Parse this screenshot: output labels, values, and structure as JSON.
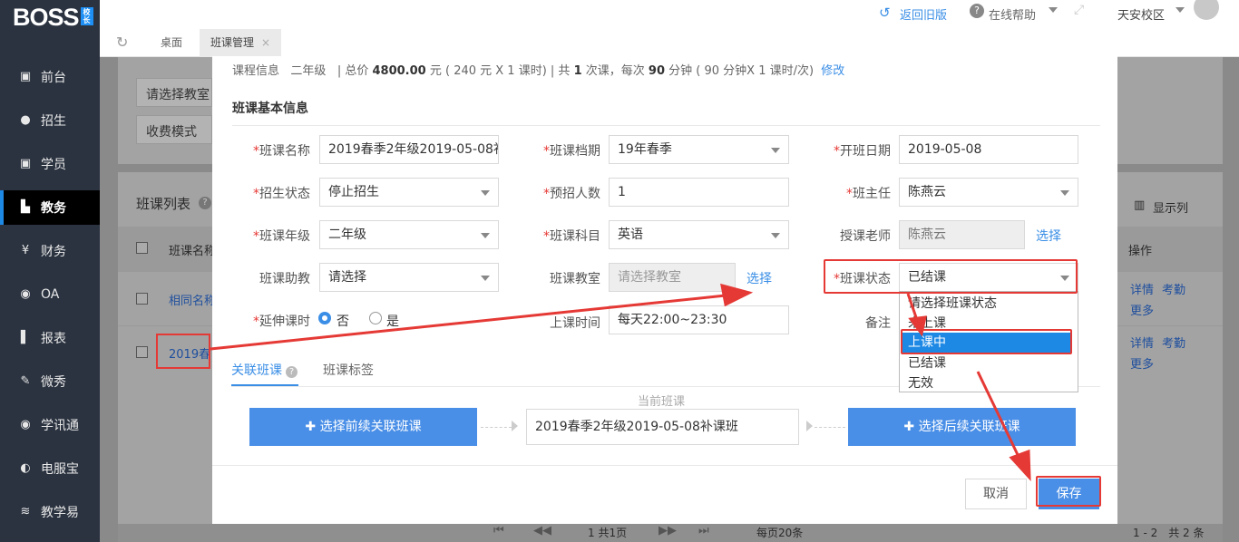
{
  "app": {
    "logo": "BOSS",
    "logo_badge": "校长"
  },
  "topbar": {
    "back_old": "返回旧版",
    "help": "在线帮助",
    "campus": "天安校区"
  },
  "tabs": [
    {
      "label": "桌面"
    },
    {
      "label": "班课管理"
    }
  ],
  "sidebar": {
    "items": [
      {
        "label": "前台",
        "icon": "desk-icon"
      },
      {
        "label": "招生",
        "icon": "person-add-icon"
      },
      {
        "label": "学员",
        "icon": "id-card-icon"
      },
      {
        "label": "教务",
        "icon": "book-icon"
      },
      {
        "label": "财务",
        "icon": "yen-icon"
      },
      {
        "label": "OA",
        "icon": "oa-icon"
      },
      {
        "label": "报表",
        "icon": "chart-icon"
      },
      {
        "label": "微秀",
        "icon": "xiu-icon"
      },
      {
        "label": "学讯通",
        "icon": "location-icon"
      },
      {
        "label": "电服宝",
        "icon": "phone-icon"
      },
      {
        "label": "教学易",
        "icon": "teach-icon"
      }
    ]
  },
  "background": {
    "filter_classroom": "请选择教室",
    "filter_fee": "收费模式",
    "list_title": "班课列表",
    "display_columns": "显示列",
    "col_name": "班课名称",
    "col_action": "操作",
    "row1_name": "相同名称",
    "row2_name": "2019春",
    "action_detail": "详情",
    "action_attendance": "考勤",
    "action_more": "更多",
    "pagination": "1 共1页",
    "per_page": "每页20条",
    "total": "1 - 2　共 2 条"
  },
  "modal": {
    "course_info_label": "课程信息",
    "course_grade": "二年级",
    "course_total_prefix": "| 总价",
    "course_total": "4800.00",
    "course_total_detail": "元 ( 240 元 X 1 课时) | 共",
    "course_times": "1",
    "course_mid": "次课，每次",
    "course_minutes": "90",
    "course_tail": "分钟 ( 90 分钟X 1 课时/次)",
    "course_edit": "修改",
    "section_title": "班课基本信息",
    "fields": {
      "class_name": {
        "label": "班课名称",
        "value": "2019春季2年级2019-05-08补"
      },
      "term": {
        "label": "班课档期",
        "value": "19年春季"
      },
      "start_date": {
        "label": "开班日期",
        "value": "2019-05-08"
      },
      "enroll_status": {
        "label": "招生状态",
        "value": "停止招生"
      },
      "planned": {
        "label": "预招人数",
        "value": "1"
      },
      "head_teacher": {
        "label": "班主任",
        "value": "陈燕云"
      },
      "grade": {
        "label": "班课年级",
        "value": "二年级"
      },
      "subject": {
        "label": "班课科目",
        "value": "英语"
      },
      "teacher": {
        "label": "授课老师",
        "value": "陈燕云",
        "action": "选择"
      },
      "assistant": {
        "label": "班课助教",
        "value": "请选择"
      },
      "classroom": {
        "label": "班课教室",
        "placeholder": "请选择教室",
        "action": "选择"
      },
      "class_status": {
        "label": "班课状态",
        "value": "已结课"
      },
      "extend": {
        "label": "延伸课时",
        "opt_no": "否",
        "opt_yes": "是"
      },
      "class_time": {
        "label": "上课时间",
        "value": "每天22:00~23:30"
      },
      "remark": {
        "label": "备注"
      }
    },
    "status_options": [
      "请选择班课状态",
      "未上课",
      "上课中",
      "已结课",
      "无效"
    ],
    "subtabs": {
      "related": "关联班课",
      "tags": "班课标签"
    },
    "current_class_label": "当前班课",
    "prev_button": "选择前续关联班课",
    "current_class": "2019春季2年级2019-05-08补课班",
    "next_button": "选择后续关联班课",
    "cancel": "取消",
    "save": "保存"
  },
  "colors": {
    "accent": "#4a8fe7",
    "annotation": "#e53935",
    "sidebar": "#2b3340"
  }
}
